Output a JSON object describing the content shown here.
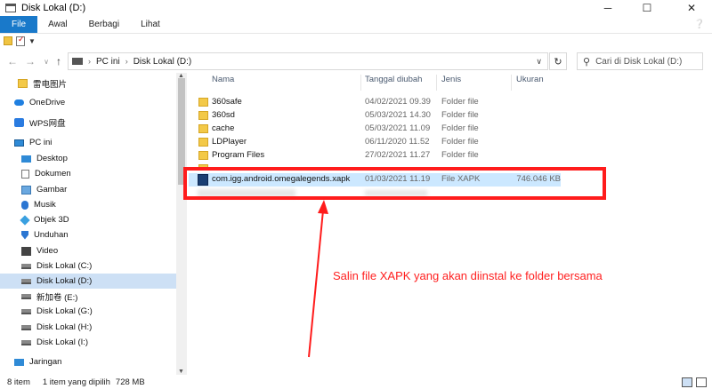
{
  "window": {
    "title": "Disk Lokal (D:)"
  },
  "controls": {
    "minimize": "─",
    "maximize": "☐",
    "close": "✕"
  },
  "ribbon": {
    "tabs": [
      "File",
      "Awal",
      "Berbagi",
      "Lihat"
    ],
    "help": "❔"
  },
  "address": {
    "crumbs": [
      "PC ini",
      "Disk Lokal (D:)"
    ],
    "search_placeholder": "Cari di Disk Lokal (D:)"
  },
  "nav": {
    "items": [
      {
        "label": "雷电图片",
        "icon": "folder-icon"
      },
      {
        "label": "OneDrive",
        "icon": "onedrive-icon"
      },
      {
        "label": "WPS网盘",
        "icon": "wps-icon"
      },
      {
        "label": "PC ini",
        "icon": "pc-icon"
      },
      {
        "label": "Desktop",
        "icon": "desktop-icon"
      },
      {
        "label": "Dokumen",
        "icon": "document-icon"
      },
      {
        "label": "Gambar",
        "icon": "picture-icon"
      },
      {
        "label": "Musik",
        "icon": "music-icon"
      },
      {
        "label": "Objek 3D",
        "icon": "3d-object-icon"
      },
      {
        "label": "Unduhan",
        "icon": "download-icon"
      },
      {
        "label": "Video",
        "icon": "video-icon"
      },
      {
        "label": "Disk Lokal (C:)",
        "icon": "drive-icon"
      },
      {
        "label": "Disk Lokal (D:)",
        "icon": "drive-icon"
      },
      {
        "label": "新加卷 (E:)",
        "icon": "drive-icon"
      },
      {
        "label": "Disk Lokal (G:)",
        "icon": "drive-icon"
      },
      {
        "label": "Disk Lokal (H:)",
        "icon": "drive-icon"
      },
      {
        "label": "Disk Lokal (I:)",
        "icon": "drive-icon"
      },
      {
        "label": "Jaringan",
        "icon": "network-icon"
      }
    ]
  },
  "columns": {
    "name": "Nama",
    "date": "Tanggal diubah",
    "type": "Jenis",
    "size": "Ukuran"
  },
  "files": [
    {
      "name": "360safe",
      "date": "04/02/2021 09.39",
      "type": "Folder file",
      "size": ""
    },
    {
      "name": "360sd",
      "date": "05/03/2021 14.30",
      "type": "Folder file",
      "size": ""
    },
    {
      "name": "cache",
      "date": "05/03/2021 11.09",
      "type": "Folder file",
      "size": ""
    },
    {
      "name": "LDPlayer",
      "date": "06/11/2020 11.52",
      "type": "Folder file",
      "size": ""
    },
    {
      "name": "Program Files",
      "date": "27/02/2021 11.27",
      "type": "Folder file",
      "size": ""
    },
    {
      "name": "com.igg.android.omegalegends.xapk",
      "date": "01/03/2021 11.19",
      "type": "File XAPK",
      "size": "746.046 KB"
    }
  ],
  "annotation": "Salin file XAPK yang akan diinstal ke folder bersama",
  "status": {
    "count": "8 item",
    "selected": "1 item yang dipilih",
    "size": "728 MB"
  }
}
